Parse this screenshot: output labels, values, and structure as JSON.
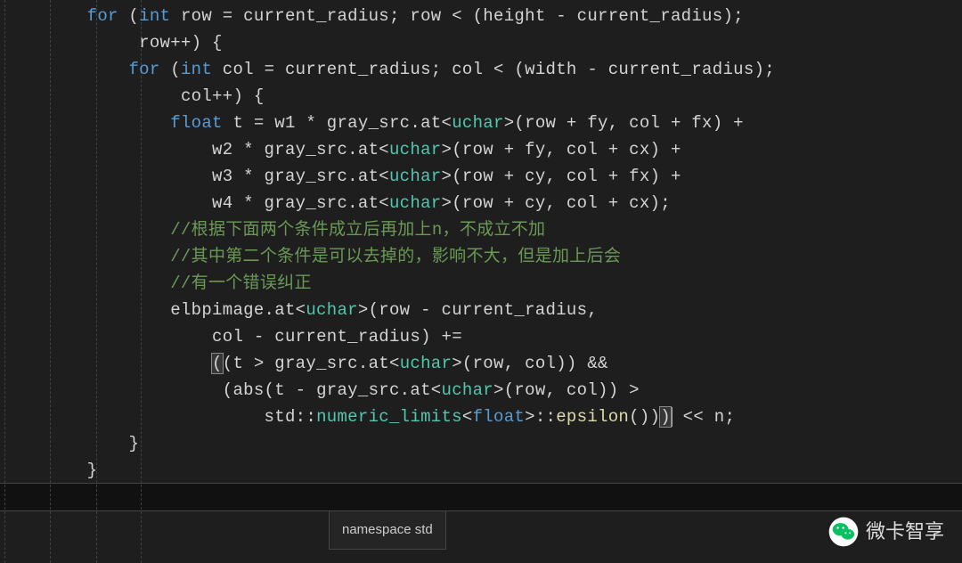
{
  "indent": "     ",
  "code": {
    "l1": {
      "kw1": "for",
      "p1": " (",
      "kw2": "int",
      "id1": " row = current_radius; row < (height - current_radius);"
    },
    "l2": {
      "txt": "row++) {"
    },
    "l3": {
      "kw1": "for",
      "p1": " (",
      "kw2": "int",
      "id1": " col = current_radius; col < (width - current_radius);"
    },
    "l4": {
      "txt": "col++) {"
    },
    "l5": {
      "kw1": "float",
      "a": " t = w1 * gray_src.at<",
      "cls": "uchar",
      "b": ">(row + fy, col + fx) +"
    },
    "l6": {
      "a": "w2 * gray_src.at<",
      "cls": "uchar",
      "b": ">(row + fy, col + cx) +"
    },
    "l7": {
      "a": "w3 * gray_src.at<",
      "cls": "uchar",
      "b": ">(row + cy, col + fx) +"
    },
    "l8": {
      "a": "w4 * gray_src.at<",
      "cls": "uchar",
      "b": ">(row + cy, col + cx);"
    },
    "l9": {
      "c": "//根据下面两个条件成立后再加上n，不成立不加"
    },
    "l10": {
      "c": "//其中第二个条件是可以去掉的，影响不大，但是加上后会"
    },
    "l11": {
      "c": "//有一个错误纠正"
    },
    "l12": {
      "a": "elbpimage.at<",
      "cls": "uchar",
      "b": ">(row - current_radius,"
    },
    "l13": {
      "txt": "col - current_radius) +="
    },
    "l14": {
      "br": "(",
      "a": "(t > gray_src.at<",
      "cls": "uchar",
      "b": ">(row, col)) &&"
    },
    "l15": {
      "a": "(abs(t - gray_src.at<",
      "cls": "uchar",
      "b": ">(row, col)) >"
    },
    "l16": {
      "ns": "std",
      "cc": "::",
      "fn": "numeric_limits",
      "lt": "<",
      "ty": "float",
      "gt": ">",
      "cc2": "::",
      "fn2": "epsilon",
      "c": "())",
      "br": ")",
      "d": " << n;"
    },
    "l17": {
      "txt": "}"
    },
    "l18": {
      "txt": "}"
    }
  },
  "tooltip": {
    "text": "namespace std"
  },
  "watermark": {
    "text": "微卡智享"
  }
}
